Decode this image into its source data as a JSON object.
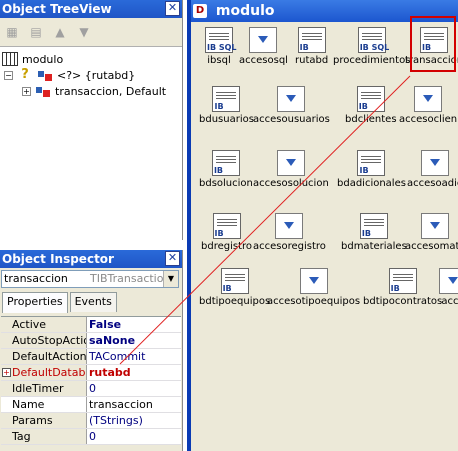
{
  "treeview": {
    "title": "Object TreeView",
    "close": "✕",
    "toolbar_icons": [
      "new-item-icon",
      "delete-item-icon",
      "move-up-icon",
      "move-down-icon"
    ],
    "nodes": [
      {
        "label": "modulo"
      },
      {
        "label": "<?> {rutabd}"
      },
      {
        "label": "transaccion, Default"
      }
    ]
  },
  "inspector": {
    "title": "Object Inspector",
    "close": "✕",
    "object_name": "transaccion",
    "object_class": "TIBTransaction",
    "tabs": [
      "Properties",
      "Events"
    ],
    "properties": [
      {
        "name": "Active",
        "value": "False",
        "bold": true
      },
      {
        "name": "AutoStopAction",
        "value": "saNone",
        "bold": true
      },
      {
        "name": "DefaultAction",
        "value": "TACommit",
        "bold": false
      },
      {
        "name": "DefaultDatabase",
        "value": "rutabd",
        "bold": true,
        "expander": "+"
      },
      {
        "name": "IdleTimer",
        "value": "0",
        "bold": false
      },
      {
        "name": "Name",
        "value": "transaccion",
        "bold": false
      },
      {
        "name": "Params",
        "value": "(TStrings)",
        "bold": false
      },
      {
        "name": "Tag",
        "value": "0",
        "bold": false
      }
    ]
  },
  "form": {
    "title": "modulo",
    "components": [
      {
        "label": "ibsql",
        "kind": "ibsql"
      },
      {
        "label": "accesosql",
        "kind": "ds"
      },
      {
        "label": "rutabd",
        "kind": "ibdb"
      },
      {
        "label": "procedimientos",
        "kind": "ibsp"
      },
      {
        "label": "transaccion",
        "kind": "trans"
      },
      {
        "label": "bdusuarios",
        "kind": "ib"
      },
      {
        "label": "accesousuarios",
        "kind": "ds"
      },
      {
        "label": "bdclientes",
        "kind": "ib"
      },
      {
        "label": "accesoclien",
        "kind": "ds"
      },
      {
        "label": "bdsolucion",
        "kind": "ib"
      },
      {
        "label": "accesosolucion",
        "kind": "ds"
      },
      {
        "label": "bdadicionales",
        "kind": "ib"
      },
      {
        "label": "accesoadic",
        "kind": "ds"
      },
      {
        "label": "bdregistro",
        "kind": "ib"
      },
      {
        "label": "accesoregistro",
        "kind": "ds"
      },
      {
        "label": "bdmateriales",
        "kind": "ib"
      },
      {
        "label": "accesomate",
        "kind": "ds"
      },
      {
        "label": "bdtipoequipos",
        "kind": "ib"
      },
      {
        "label": "accesotipoequipos",
        "kind": "ds"
      },
      {
        "label": "bdtipocontratos",
        "kind": "ib"
      },
      {
        "label": "acce",
        "kind": "ds"
      }
    ]
  }
}
